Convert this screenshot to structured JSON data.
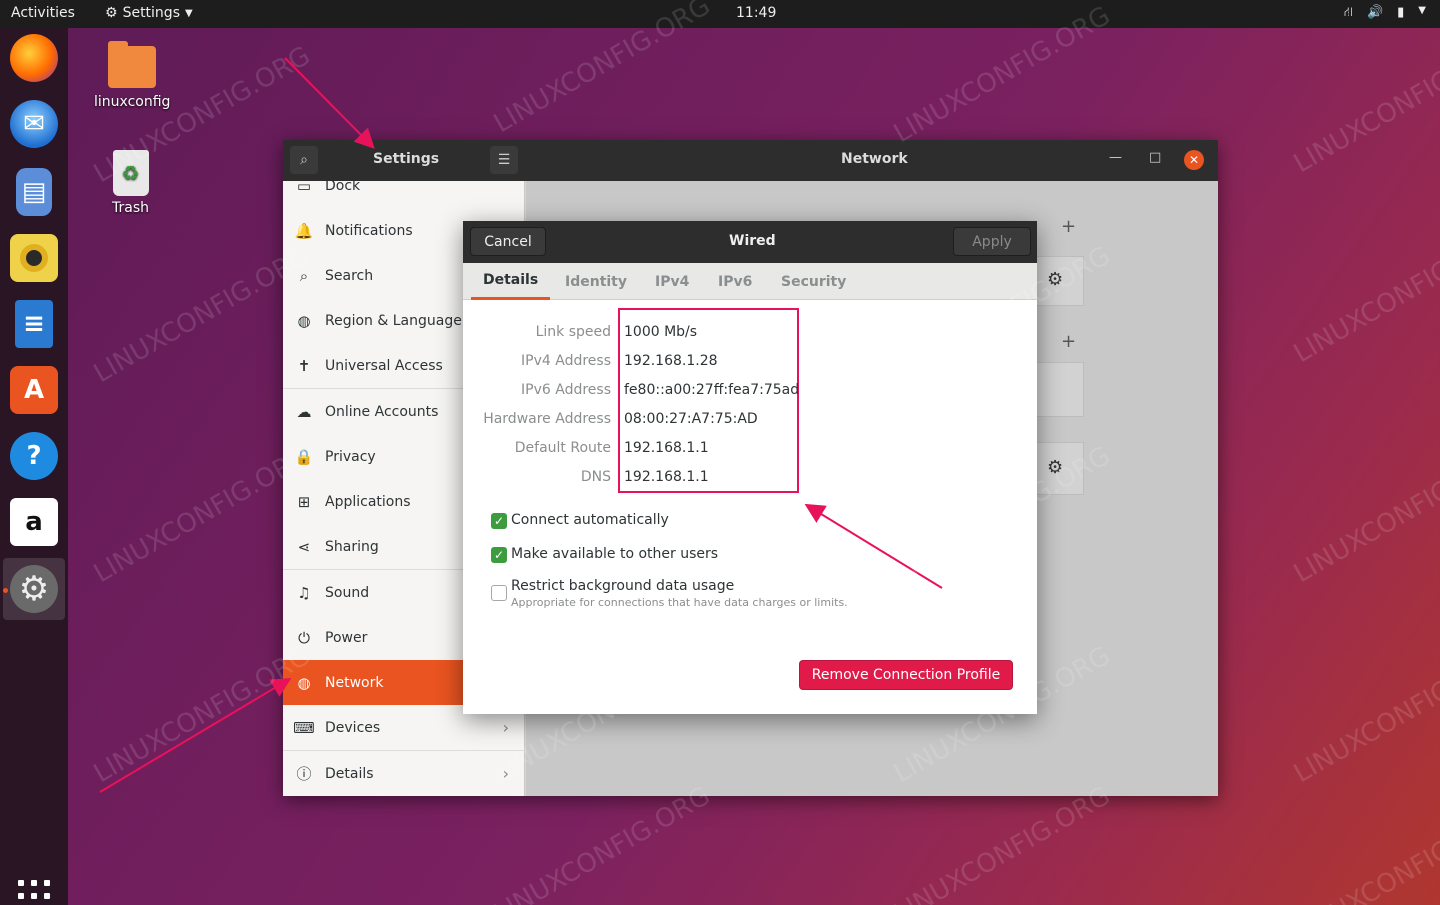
{
  "topbar": {
    "activities": "Activities",
    "app_menu": "Settings",
    "clock": "11:49"
  },
  "desktop": {
    "home_folder": "linuxconfig",
    "trash": "Trash"
  },
  "dock_apps": [
    "firefox-icon",
    "thunderbird-icon",
    "files-icon",
    "rhythmbox-icon",
    "writer-icon",
    "software-icon",
    "help-icon",
    "amazon-icon",
    "settings-icon"
  ],
  "settings": {
    "title": "Settings",
    "panel_title": "Network",
    "sidebar": [
      {
        "label": "Dock",
        "icon": "dock-icon"
      },
      {
        "label": "Notifications",
        "icon": "bell-icon"
      },
      {
        "label": "Search",
        "icon": "search-icon"
      },
      {
        "label": "Region & Language",
        "icon": "globe-icon"
      },
      {
        "label": "Universal Access",
        "icon": "accessibility-icon"
      },
      {
        "label": "Online Accounts",
        "icon": "cloud-icon"
      },
      {
        "label": "Privacy",
        "icon": "lock-icon"
      },
      {
        "label": "Applications",
        "icon": "apps-icon"
      },
      {
        "label": "Sharing",
        "icon": "share-icon"
      },
      {
        "label": "Sound",
        "icon": "music-icon"
      },
      {
        "label": "Power",
        "icon": "power-icon"
      },
      {
        "label": "Network",
        "icon": "network-icon",
        "active": true
      },
      {
        "label": "Devices",
        "icon": "devices-icon"
      },
      {
        "label": "Details",
        "icon": "info-icon"
      }
    ]
  },
  "dialog": {
    "cancel": "Cancel",
    "title": "Wired",
    "apply": "Apply",
    "tabs": [
      "Details",
      "Identity",
      "IPv4",
      "IPv6",
      "Security"
    ],
    "active_tab": "Details",
    "details": [
      {
        "label": "Link speed",
        "value": "1000 Mb/s"
      },
      {
        "label": "IPv4 Address",
        "value": "192.168.1.28"
      },
      {
        "label": "IPv6 Address",
        "value": "fe80::a00:27ff:fea7:75ad"
      },
      {
        "label": "Hardware Address",
        "value": "08:00:27:A7:75:AD"
      },
      {
        "label": "Default Route",
        "value": "192.168.1.1"
      },
      {
        "label": "DNS",
        "value": "192.168.1.1"
      }
    ],
    "options": {
      "connect_auto": {
        "label": "Connect automatically",
        "checked": true
      },
      "available_all": {
        "label": "Make available to other users",
        "checked": true
      },
      "restrict_bg": {
        "label": "Restrict background data usage",
        "sublabel": "Appropriate for connections that have data charges or limits.",
        "checked": false
      }
    },
    "remove_button": "Remove Connection Profile"
  },
  "watermark": "LINUXCONFIG.ORG",
  "colors": {
    "accent": "#e95420",
    "highlight_box": "#e8125a",
    "remove_button": "#e01b4a"
  }
}
